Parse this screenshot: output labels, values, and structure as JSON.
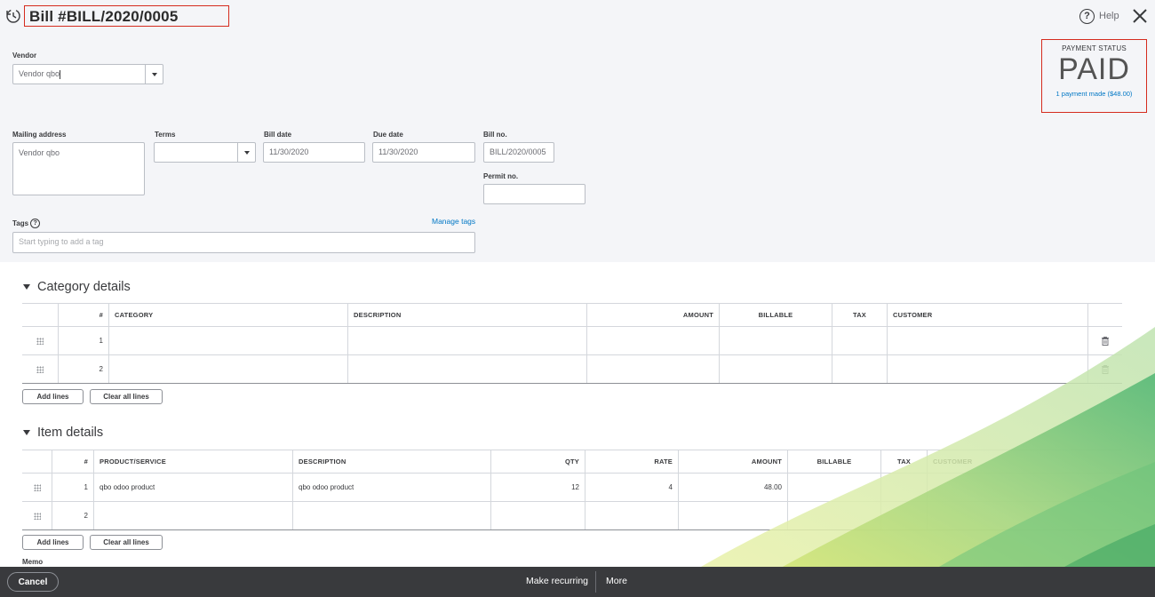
{
  "header": {
    "title": "Bill #BILL/2020/0005",
    "help_label": "Help"
  },
  "payment": {
    "status_label": "PAYMENT STATUS",
    "status_value": "PAID",
    "payments_link": "1 payment made ($48.00)"
  },
  "form": {
    "vendor_label": "Vendor",
    "vendor_value": "Vendor qbo",
    "mailing_label": "Mailing address",
    "mailing_value": "Vendor qbo",
    "terms_label": "Terms",
    "terms_value": "",
    "bill_date_label": "Bill date",
    "bill_date_value": "11/30/2020",
    "due_date_label": "Due date",
    "due_date_value": "11/30/2020",
    "bill_no_label": "Bill no.",
    "bill_no_value": "BILL/2020/0005",
    "permit_label": "Permit no.",
    "permit_value": "",
    "tags_label": "Tags",
    "tags_help": "?",
    "tags_placeholder": "Start typing to add a tag",
    "manage_tags": "Manage tags"
  },
  "category_details": {
    "title": "Category details",
    "columns": [
      "#",
      "CATEGORY",
      "DESCRIPTION",
      "AMOUNT",
      "BILLABLE",
      "TAX",
      "CUSTOMER"
    ],
    "rows": [
      {
        "num": "1",
        "category": "",
        "description": "",
        "amount": "",
        "billable": "",
        "tax": "",
        "customer": ""
      },
      {
        "num": "2",
        "category": "",
        "description": "",
        "amount": "",
        "billable": "",
        "tax": "",
        "customer": ""
      }
    ],
    "add_lines": "Add lines",
    "clear_lines": "Clear all lines"
  },
  "item_details": {
    "title": "Item details",
    "columns": [
      "#",
      "PRODUCT/SERVICE",
      "DESCRIPTION",
      "QTY",
      "RATE",
      "AMOUNT",
      "BILLABLE",
      "TAX",
      "CUSTOMER"
    ],
    "rows": [
      {
        "num": "1",
        "product": "qbo odoo product",
        "description": "qbo odoo product",
        "qty": "12",
        "rate": "4",
        "amount": "48.00",
        "billable": "",
        "tax": "",
        "customer": ""
      },
      {
        "num": "2",
        "product": "",
        "description": "",
        "qty": "",
        "rate": "",
        "amount": "",
        "billable": "",
        "tax": "",
        "customer": ""
      }
    ],
    "add_lines": "Add lines",
    "clear_lines": "Clear all lines"
  },
  "memo_label": "Memo",
  "footer": {
    "cancel": "Cancel",
    "make_recurring": "Make recurring",
    "more": "More"
  },
  "colors": {
    "highlight_border": "#d52b1e",
    "link": "#0077c5",
    "footer_bg": "#393a3d"
  }
}
